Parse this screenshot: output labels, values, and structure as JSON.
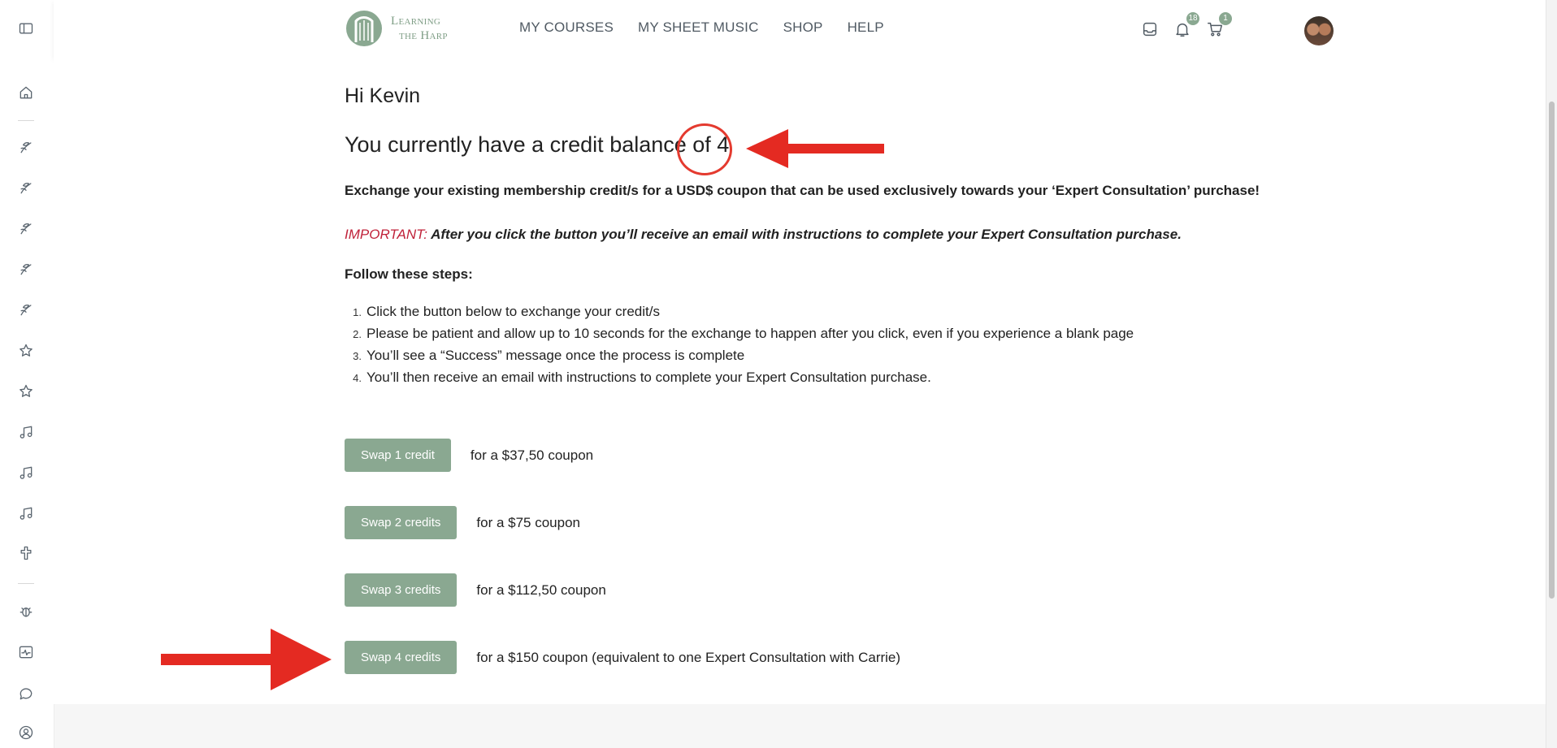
{
  "brand": {
    "logo_line1": "Learning",
    "logo_line2": "the Harp",
    "accent_color": "#8aa891",
    "alert_color": "#c0223a"
  },
  "nav": {
    "items": [
      "MY COURSES",
      "MY SHEET MUSIC",
      "SHOP",
      "HELP"
    ]
  },
  "header": {
    "notifications_count": "18",
    "cart_count": "1"
  },
  "sidebar": {
    "icons": [
      "sidebar-toggle-icon",
      "home-icon",
      "course-icon",
      "course-icon",
      "course-icon",
      "course-icon",
      "course-icon",
      "star-icon",
      "star-icon",
      "music-note-icon",
      "music-note-icon",
      "music-note-icon",
      "cross-icon",
      "bug-icon",
      "activity-icon",
      "chat-icon",
      "user-icon"
    ]
  },
  "main": {
    "greeting": "Hi Kevin",
    "balance_text": "You currently have a credit balance of 4",
    "exchange_text": "Exchange your existing membership credit/s for a USD$ coupon that can be used exclusively towards your ‘Expert Consultation’ purchase!",
    "important_label": "IMPORTANT:",
    "important_text": " After you click the button you’ll receive an email with instructions to complete your Expert Consultation purchase.",
    "steps_title": "Follow these steps:",
    "steps": [
      "Click the button below to exchange your credit/s",
      "Please be patient and allow up to 10 seconds for the exchange to happen after you click, even if you experience a blank page",
      "You’ll see a “Success” message once the process is complete",
      "You’ll then receive an email with instructions to complete your Expert Consultation purchase."
    ],
    "swaps": [
      {
        "label": "Swap 1 credit",
        "desc": "for a $37,50 coupon"
      },
      {
        "label": "Swap 2 credits",
        "desc": "for a $75 coupon"
      },
      {
        "label": "Swap 3 credits",
        "desc": "for a $112,50 coupon"
      },
      {
        "label": "Swap 4 credits",
        "desc": "for a $150 coupon (equivalent to one Expert Consultation with Carrie)"
      }
    ]
  }
}
